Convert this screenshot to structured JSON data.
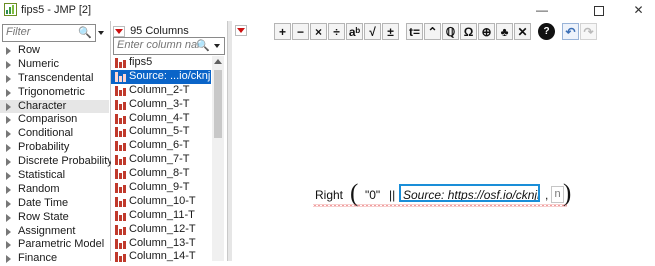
{
  "window": {
    "title": "fips5 - JMP [2]",
    "min_glyph": "—",
    "close_glyph": "✕",
    "icons": {
      "app": "jmp-app-icon",
      "minimize": "minimize-icon",
      "maximize": "maximize-icon",
      "close": "close-icon"
    }
  },
  "functions_panel": {
    "filter_placeholder": "Filter",
    "search_glyph": "🔍",
    "categories": [
      {
        "label": "Row"
      },
      {
        "label": "Numeric"
      },
      {
        "label": "Transcendental"
      },
      {
        "label": "Trigonometric"
      },
      {
        "label": "Character",
        "selected": true
      },
      {
        "label": "Comparison"
      },
      {
        "label": "Conditional"
      },
      {
        "label": "Probability"
      },
      {
        "label": "Discrete Probability"
      },
      {
        "label": "Statistical"
      },
      {
        "label": "Random"
      },
      {
        "label": "Date Time"
      },
      {
        "label": "Row State"
      },
      {
        "label": "Assignment"
      },
      {
        "label": "Parametric Model"
      },
      {
        "label": "Finance"
      }
    ]
  },
  "columns_panel": {
    "count_label": "95 Columns",
    "search_placeholder": "Enter column name",
    "search_glyph": "🔍",
    "columns": [
      {
        "label": "fips5"
      },
      {
        "label": "Source: ...io/cknjr/",
        "selected": true
      },
      {
        "label": "Column_2-T"
      },
      {
        "label": "Column_3-T"
      },
      {
        "label": "Column_4-T"
      },
      {
        "label": "Column_5-T"
      },
      {
        "label": "Column_6-T"
      },
      {
        "label": "Column_7-T"
      },
      {
        "label": "Column_8-T"
      },
      {
        "label": "Column_9-T"
      },
      {
        "label": "Column_10-T"
      },
      {
        "label": "Column_11-T"
      },
      {
        "label": "Column_12-T"
      },
      {
        "label": "Column_13-T"
      },
      {
        "label": "Column_14-T"
      }
    ],
    "column_icon": "nominal-bar-icon"
  },
  "toolbar": {
    "buttons": [
      {
        "name": "add-button",
        "glyph": "+"
      },
      {
        "name": "subtract-button",
        "glyph": "−"
      },
      {
        "name": "multiply-button",
        "glyph": "×"
      },
      {
        "name": "divide-button",
        "glyph": "÷"
      },
      {
        "name": "power-button",
        "glyph": "aᵇ"
      },
      {
        "name": "root-button",
        "glyph": "√"
      },
      {
        "name": "change-sign-button",
        "glyph": "±"
      },
      {
        "name": "assign-button",
        "glyph": "t="
      },
      {
        "name": "raise-level-button",
        "glyph": "⌃"
      },
      {
        "name": "peel-button",
        "glyph": "ℚ"
      },
      {
        "name": "unthread-button",
        "glyph": "Ω"
      },
      {
        "name": "keep-button",
        "glyph": "⊕"
      },
      {
        "name": "local-button",
        "glyph": "♣"
      },
      {
        "name": "delete-button",
        "glyph": "✕"
      },
      {
        "name": "help-button",
        "glyph": "?"
      },
      {
        "name": "undo-button",
        "glyph": "↶"
      },
      {
        "name": "redo-button",
        "glyph": "↷"
      }
    ]
  },
  "formula": {
    "function_name": "Right",
    "left_paren": "(",
    "right_paren": ")",
    "first_arg": "\"0\"",
    "concat_op": "||",
    "selected_arg": "Source: https://osf.io/cknjr/",
    "comma": ",",
    "n_placeholder": "n"
  }
}
